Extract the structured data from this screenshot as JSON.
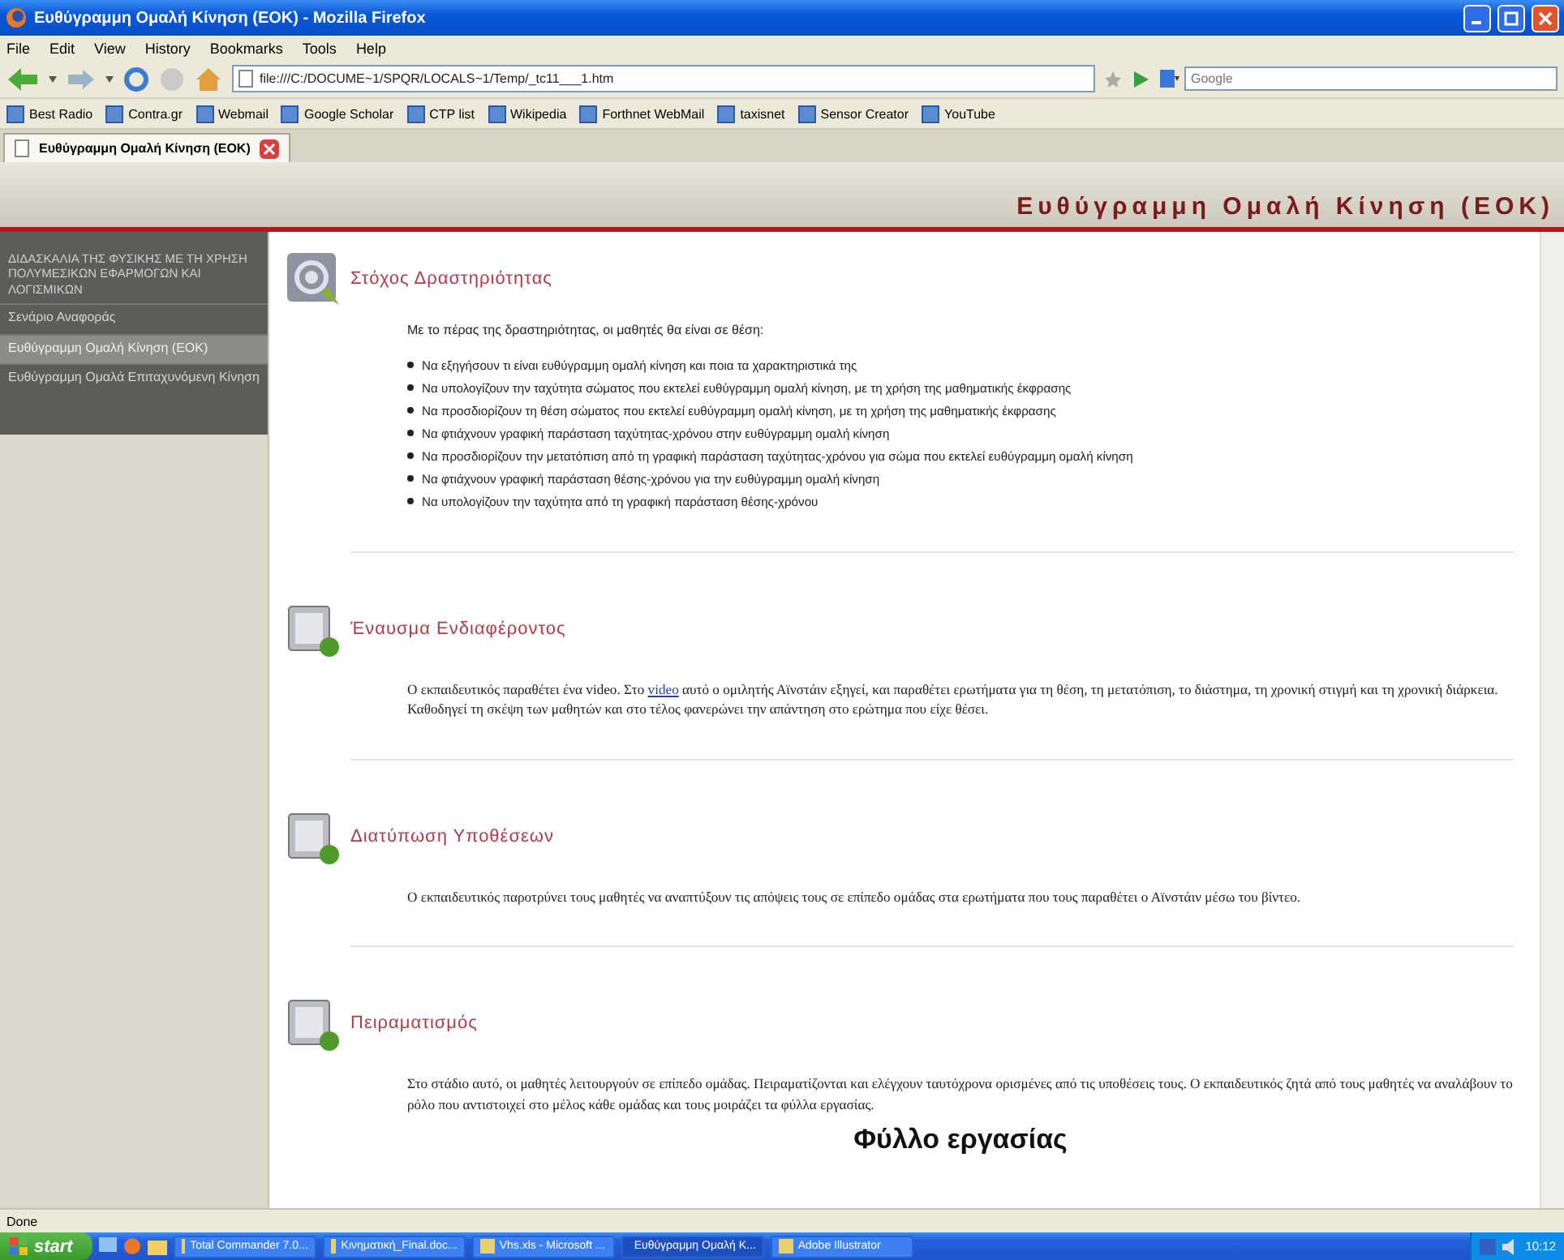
{
  "window": {
    "title": "Ευθύγραμμη Ομαλή Κίνηση (ΕΟΚ) - Mozilla Firefox"
  },
  "menu": [
    "File",
    "Edit",
    "View",
    "History",
    "Bookmarks",
    "Tools",
    "Help"
  ],
  "address_bar": {
    "value": "file:///C:/DOCUME~1/SPQR/LOCALS~1/Temp/_tc11___1.htm"
  },
  "search": {
    "placeholder": "Google"
  },
  "bookmarks": [
    {
      "label": "Best Radio"
    },
    {
      "label": "Contra.gr"
    },
    {
      "label": "Webmail"
    },
    {
      "label": "Google Scholar"
    },
    {
      "label": "CTP list"
    },
    {
      "label": "Wikipedia"
    },
    {
      "label": "Forthnet WebMail"
    },
    {
      "label": "taxisnet"
    },
    {
      "label": "Sensor Creator"
    },
    {
      "label": "YouTube"
    }
  ],
  "tabs": [
    {
      "label": "Ευθύγραμμη Ομαλή Κίνηση (ΕΟΚ)",
      "selected": true
    }
  ],
  "page": {
    "header": "Ευθύγραμμη Ομαλή Κίνηση (ΕΟΚ)",
    "sidebar": {
      "heading": "ΔΙΔΑΣΚΑΛΙΑ ΤΗΣ ΦΥΣΙΚΗΣ ΜΕ ΤΗ ΧΡΗΣΗ ΠΟΛΥΜΕΣΙΚΩΝ ΕΦΑΡΜΟΓΩΝ ΚΑΙ ΛΟΓΙΣΜΙΚΩΝ",
      "items": [
        {
          "label": "Σενάριο Αναφοράς",
          "selected": false
        },
        {
          "label": "Ευθύγραμμη Ομαλή Κίνηση (ΕΟΚ)",
          "selected": true
        },
        {
          "label": "Ευθύγραμμη Ομαλά Επιταχυνόμενη Κίνηση",
          "selected": false
        }
      ]
    },
    "sections": [
      {
        "title": "Στόχος Δραστηριότητας",
        "intro": "Με το πέρας της δραστηριότητας, οι μαθητές θα είναι σε θέση:",
        "bullets": [
          "Να εξηγήσουν τι είναι ευθύγραμμη ομαλή κίνηση και ποια τα χαρακτηριστικά της",
          "Να υπολογίζουν την ταχύτητα σώματος που εκτελεί ευθύγραμμη ομαλή κίνηση, με τη χρήση της μαθηματικής έκφρασης",
          "Να προσδιορίζουν τη θέση σώματος που εκτελεί ευθύγραμμη ομαλή κίνηση, με τη χρήση της μαθηματικής έκφρασης",
          "Να φτιάχνουν γραφική παράσταση ταχύτητας-χρόνου στην ευθύγραμμη ομαλή κίνηση",
          "Να προσδιορίζουν την μετατόπιση από τη γραφική παράσταση ταχύτητας-χρόνου για σώμα που εκτελεί ευθύγραμμη ομαλή κίνηση",
          "Να φτιάχνουν γραφική παράσταση θέσης-χρόνου για την ευθύγραμμη ομαλή κίνηση",
          "Να υπολογίζουν την ταχύτητα από τη γραφική παράσταση θέσης-χρόνου"
        ]
      },
      {
        "title": "Έναυσμα Ενδιαφέροντος",
        "paragraph": [
          {
            "kind": "text",
            "text": "Ο εκπαιδευτικός παραθέτει ένα video. Στο "
          },
          {
            "kind": "link",
            "text": "video"
          },
          {
            "kind": "text",
            "text": " αυτό ο ομιλητής Αϊνστάιν εξηγεί, και παραθέτει ερωτήματα για τη θέση, τη μετατόπιση, το διάστημα, τη χρονική στιγμή και τη χρονική διάρκεια. Καθοδηγεί τη σκέψη των μαθητών και στο τέλος φανερώνει την απάντηση στο ερώτημα που είχε θέσει."
          }
        ]
      },
      {
        "title": "Διατύπωση Υποθέσεων",
        "paragraph": [
          {
            "kind": "text",
            "text": "Ο εκπαιδευτικός παροτρύνει τους μαθητές να αναπτύξουν τις απόψεις τους σε επίπεδο ομάδας στα ερωτήματα που τους παραθέτει ο Αϊνστάιν μέσω του βίντεο."
          }
        ]
      },
      {
        "title": "Πειραματισμός",
        "paragraph": [
          {
            "kind": "text",
            "text": "Στο στάδιο αυτό, οι μαθητές λειτουργούν σε επίπεδο ομάδας. Πειραματίζονται και ελέγχουν ταυτόχρονα ορισμένες από τις υποθέσεις τους. Ο εκπαιδευτικός ζητά από τους μαθητές να αναλάβουν το ρόλο που αντιστοιχεί στο μέλος κάθε ομάδας και τους μοιράζει τα φύλλα εργασίας."
          }
        ],
        "subheading": "Φύλλο εργασίας"
      }
    ]
  },
  "status_bar": "Done",
  "taskbar": {
    "start": "start",
    "tasks": [
      {
        "label": "Total Commander 7.0...",
        "selected": false
      },
      {
        "label": "Κινηματική_Final.doc...",
        "selected": false
      },
      {
        "label": "Vhs.xls - Microsoft ...",
        "selected": false
      },
      {
        "label": "Ευθύγραμμη Ομαλή Κ...",
        "selected": true
      },
      {
        "label": "Adobe Illustrator",
        "selected": false
      }
    ],
    "clock": "10:12"
  }
}
